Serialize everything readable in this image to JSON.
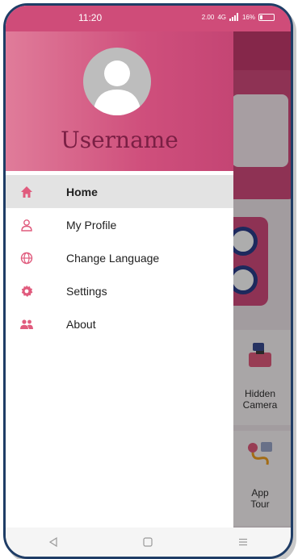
{
  "status_bar": {
    "time": "11:20",
    "speed": "2.00",
    "network": "4G",
    "battery_text": "16%",
    "battery_level": 0.16
  },
  "drawer": {
    "username": "Username",
    "menu": [
      {
        "label": "Home",
        "icon": "home-icon",
        "active": true
      },
      {
        "label": "My Profile",
        "icon": "person-icon",
        "active": false
      },
      {
        "label": "Change Language",
        "icon": "globe-icon",
        "active": false
      },
      {
        "label": "Settings",
        "icon": "gear-icon",
        "active": false
      },
      {
        "label": "About",
        "icon": "group-icon",
        "active": false
      }
    ]
  },
  "background": {
    "tiles": [
      {
        "label": "Hidden\nCamera"
      },
      {
        "label": "App\nTour"
      }
    ]
  },
  "colors": {
    "accent": "#cf4c79",
    "username": "#7a1f44",
    "active_row": "#e3e3e3",
    "frame": "#1f3d66"
  }
}
